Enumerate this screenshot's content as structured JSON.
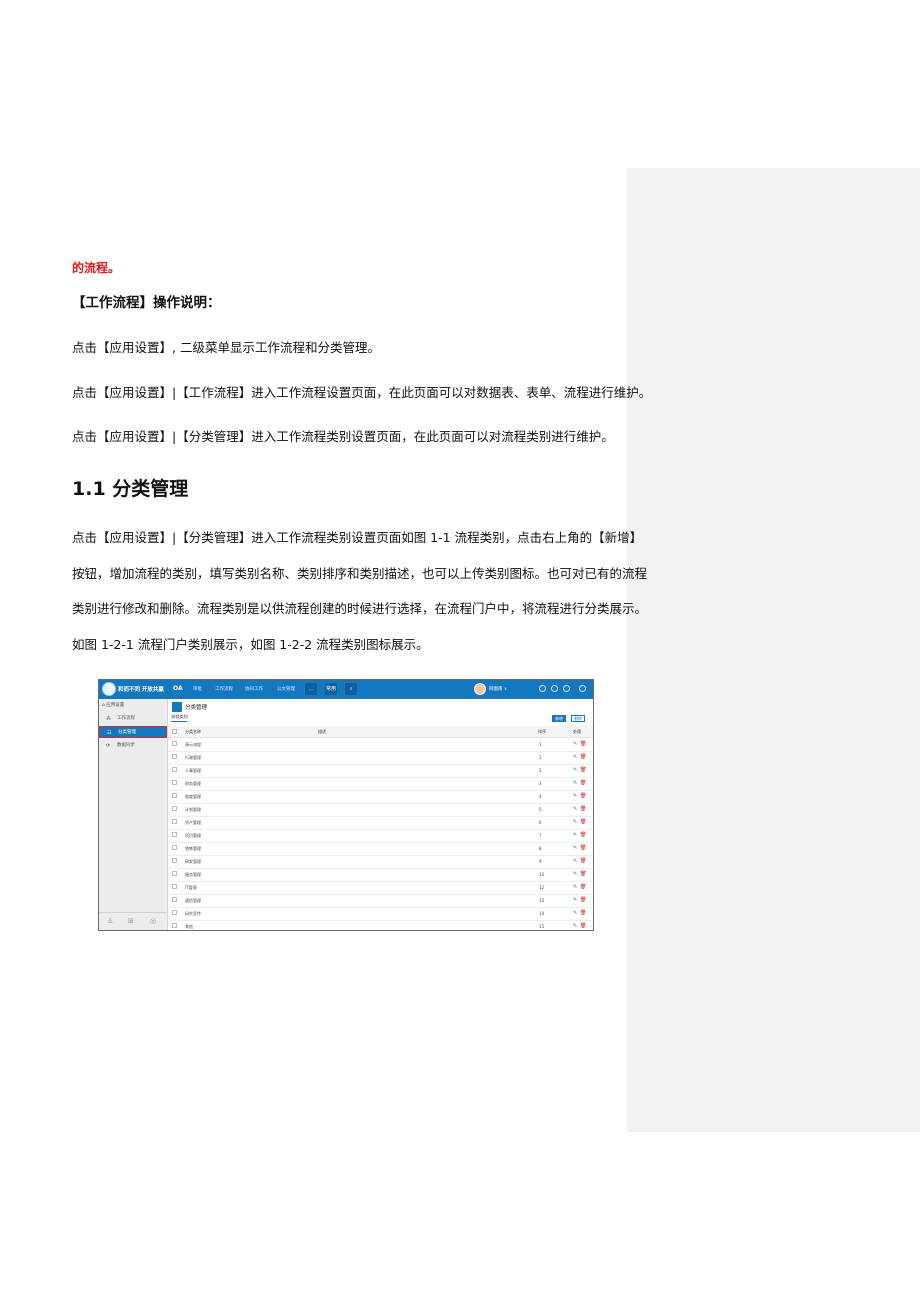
{
  "document": {
    "red_line": "的流程。",
    "section_heading": "【工作流程】操作说明：",
    "para1": "点击【应用设置】, 二级菜单显示工作流程和分类管理。",
    "para2": "点击【应用设置】|【工作流程】进入工作流程设置页面，在此页面可以对数据表、表单、流程进行维护。",
    "para3": "点击【应用设置】|【分类管理】进入工作流程类别设置页面，在此页面可以对流程类别进行维护。",
    "heading": "1.1 分类管理",
    "body_lines": [
      "点击【应用设置】|【分类管理】进入工作流程类别设置页面如图 1-1  流程类别，点击右上角的【新增】",
      "按钮，增加流程的类别，填写类别名称、类别排序和类别描述，也可以上传类别图标。也可对已有的流程",
      "类别进行修改和删除。流程类别是以供流程创建的时候进行选择，在流程门户中，将流程进行分类展示。",
      "如图 1-2-1  流程门户类别展示，如图 1-2-2 流程类别图标展示。"
    ]
  },
  "screenshot": {
    "brand": "和而不同 开放共赢",
    "oa_label": "OA",
    "nav": [
      "审批",
      "工作流程",
      "协同工作",
      "公文管理",
      "...",
      "常用"
    ],
    "user_name": "阿图南 ∨",
    "sidebar": {
      "title": "应用设置",
      "items": [
        "工作流程",
        "分类管理",
        "数据同步"
      ]
    },
    "main": {
      "title": "分类管理",
      "tab": "流程类别",
      "btn_new": "新增",
      "btn_delete": "删除",
      "columns": {
        "name": "分类名称",
        "desc": "描述",
        "sort": "排序",
        "action": "处理"
      },
      "rows": [
        {
          "name": "演示流程",
          "sort": "1"
        },
        {
          "name": "行政管理",
          "sort": "1"
        },
        {
          "name": "人事管理",
          "sort": "2"
        },
        {
          "name": "财务管理",
          "sort": "3"
        },
        {
          "name": "制度管理",
          "sort": "4"
        },
        {
          "name": "计划管理",
          "sort": "5"
        },
        {
          "name": "资产管理",
          "sort": "6"
        },
        {
          "name": "项目管理",
          "sort": "7"
        },
        {
          "name": "销售管理",
          "sort": "8"
        },
        {
          "name": "研发管理",
          "sort": "9"
        },
        {
          "name": "服务管理",
          "sort": "10"
        },
        {
          "name": "IT管理",
          "sort": "12"
        },
        {
          "name": "通信管理",
          "sort": "13"
        },
        {
          "name": "研究宣传",
          "sort": "14"
        },
        {
          "name": "其他",
          "sort": "15"
        }
      ]
    }
  }
}
